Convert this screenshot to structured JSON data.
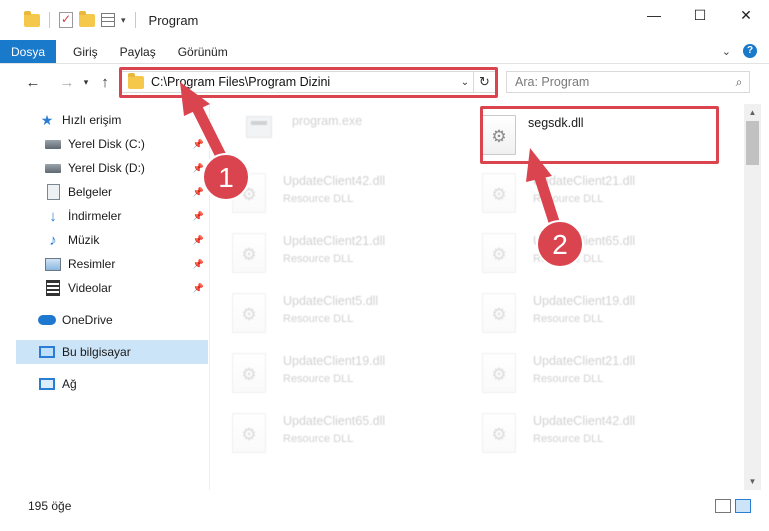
{
  "window": {
    "title": "Program",
    "controls": {
      "minimize": "—",
      "maximize": "☐",
      "close": "✕"
    }
  },
  "ribbon": {
    "tabs": [
      {
        "label": "Dosya",
        "active": true
      },
      {
        "label": "Giriş"
      },
      {
        "label": "Paylaş"
      },
      {
        "label": "Görünüm"
      }
    ],
    "help_label": "?"
  },
  "address": {
    "path": "C:\\Program Files\\Program Dizini",
    "search_placeholder": "Ara: Program"
  },
  "sidebar": {
    "items": [
      {
        "label": "Hızlı erişim",
        "icon": "star-icon"
      },
      {
        "label": "Yerel Disk (C:)",
        "icon": "disk-icon",
        "pinned": true
      },
      {
        "label": "Yerel Disk (D:)",
        "icon": "disk-icon",
        "pinned": true
      },
      {
        "label": "Belgeler",
        "icon": "documents-icon",
        "pinned": true
      },
      {
        "label": "İndirmeler",
        "icon": "downloads-icon",
        "pinned": true
      },
      {
        "label": "Müzik",
        "icon": "music-icon",
        "pinned": true
      },
      {
        "label": "Resimler",
        "icon": "pictures-icon",
        "pinned": true
      },
      {
        "label": "Videolar",
        "icon": "videos-icon",
        "pinned": true
      },
      {
        "label": "OneDrive",
        "icon": "onedrive-icon"
      },
      {
        "label": "Bu bilgisayar",
        "icon": "this-pc-icon",
        "selected": true
      },
      {
        "label": "Ağ",
        "icon": "network-icon"
      }
    ]
  },
  "files": {
    "highlighted": {
      "name": "segsdk.dll"
    },
    "program": {
      "name": "program.exe"
    },
    "items": [
      {
        "name": "UpdateClient42.dll",
        "desc": "Resource DLL"
      },
      {
        "name": "UpdateClient21.dll",
        "desc": "Resource DLL"
      },
      {
        "name": "UpdateClient21.dll",
        "desc": "Resource DLL"
      },
      {
        "name": "UpdateClient65.dll",
        "desc": "Resource DLL"
      },
      {
        "name": "UpdateClient5.dll",
        "desc": "Resource DLL"
      },
      {
        "name": "UpdateClient19.dll",
        "desc": "Resource DLL"
      },
      {
        "name": "UpdateClient19.dll",
        "desc": "Resource DLL"
      },
      {
        "name": "UpdateClient21.dll",
        "desc": "Resource DLL"
      },
      {
        "name": "UpdateClient65.dll",
        "desc": "Resource DLL"
      },
      {
        "name": "UpdateClient42.dll",
        "desc": "Resource DLL"
      }
    ]
  },
  "status": {
    "count": "195 öğe"
  },
  "annotations": {
    "color": "#d9444f",
    "step1": "1",
    "step2": "2"
  }
}
